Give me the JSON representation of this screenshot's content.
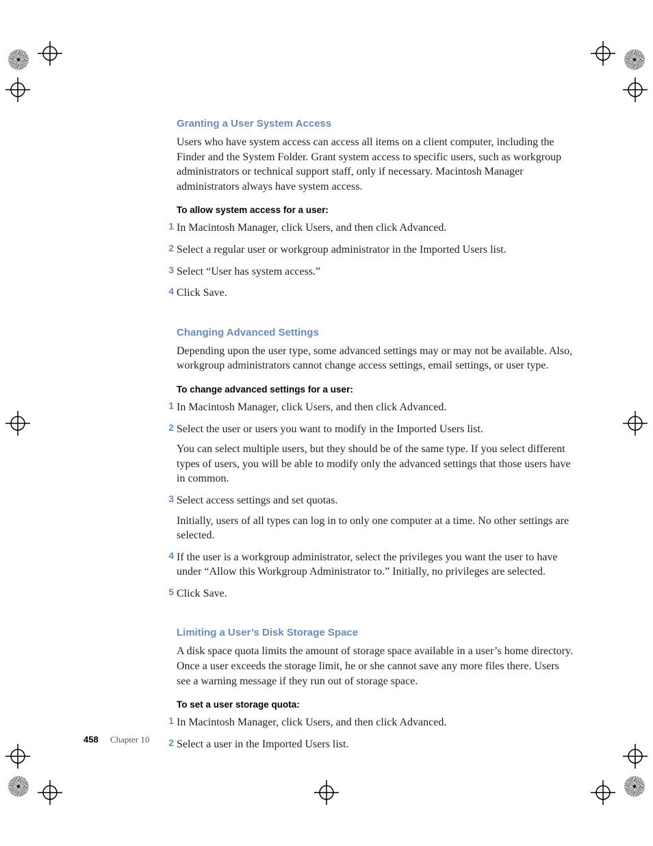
{
  "footer": {
    "page_number": "458",
    "chapter": "Chapter 10"
  },
  "sections": [
    {
      "heading": "Granting a User System Access",
      "intro": "Users who have system access can access all items on a client computer, including the Finder and the System Folder. Grant system access to specific users, such as workgroup administrators or technical support staff, only if necessary. Macintosh Manager administrators always have system access.",
      "sub": "To allow system access for a user:",
      "steps": [
        {
          "n": "1",
          "text": "In Macintosh Manager, click Users, and then click Advanced."
        },
        {
          "n": "2",
          "text": "Select a regular user or workgroup administrator in the Imported Users list."
        },
        {
          "n": "3",
          "text": "Select “User has system access.”"
        },
        {
          "n": "4",
          "text": "Click Save."
        }
      ]
    },
    {
      "heading": "Changing Advanced Settings",
      "intro": "Depending upon the user type, some advanced settings may or may not be available. Also, workgroup administrators cannot change access settings, email settings, or user type.",
      "sub": "To change advanced settings for a user:",
      "steps": [
        {
          "n": "1",
          "text": "In Macintosh Manager, click Users, and then click Advanced."
        },
        {
          "n": "2",
          "text": "Select the user or users you want to modify in the Imported Users list.",
          "note": "You can select multiple users, but they should be of the same type. If you select different types of users, you will be able to modify only the advanced settings that those users have in common."
        },
        {
          "n": "3",
          "text": "Select access settings and set quotas.",
          "note": "Initially, users of all types can log in to only one computer at a time. No other settings are selected."
        },
        {
          "n": "4",
          "text": "If the user is a workgroup administrator, select the privileges you want the user to have under “Allow this Workgroup Administrator to.” Initially, no privileges are selected."
        },
        {
          "n": "5",
          "text": "Click Save."
        }
      ]
    },
    {
      "heading": "Limiting a User’s Disk Storage Space",
      "intro": "A disk space quota limits the amount of storage space available in a user’s home directory. Once a user exceeds the storage limit, he or she cannot save any more files there. Users see a warning message if they run out of storage space.",
      "sub": "To set a user storage quota:",
      "steps": [
        {
          "n": "1",
          "text": "In Macintosh Manager, click Users, and then click Advanced."
        },
        {
          "n": "2",
          "text": "Select a user in the Imported Users list."
        }
      ]
    }
  ]
}
